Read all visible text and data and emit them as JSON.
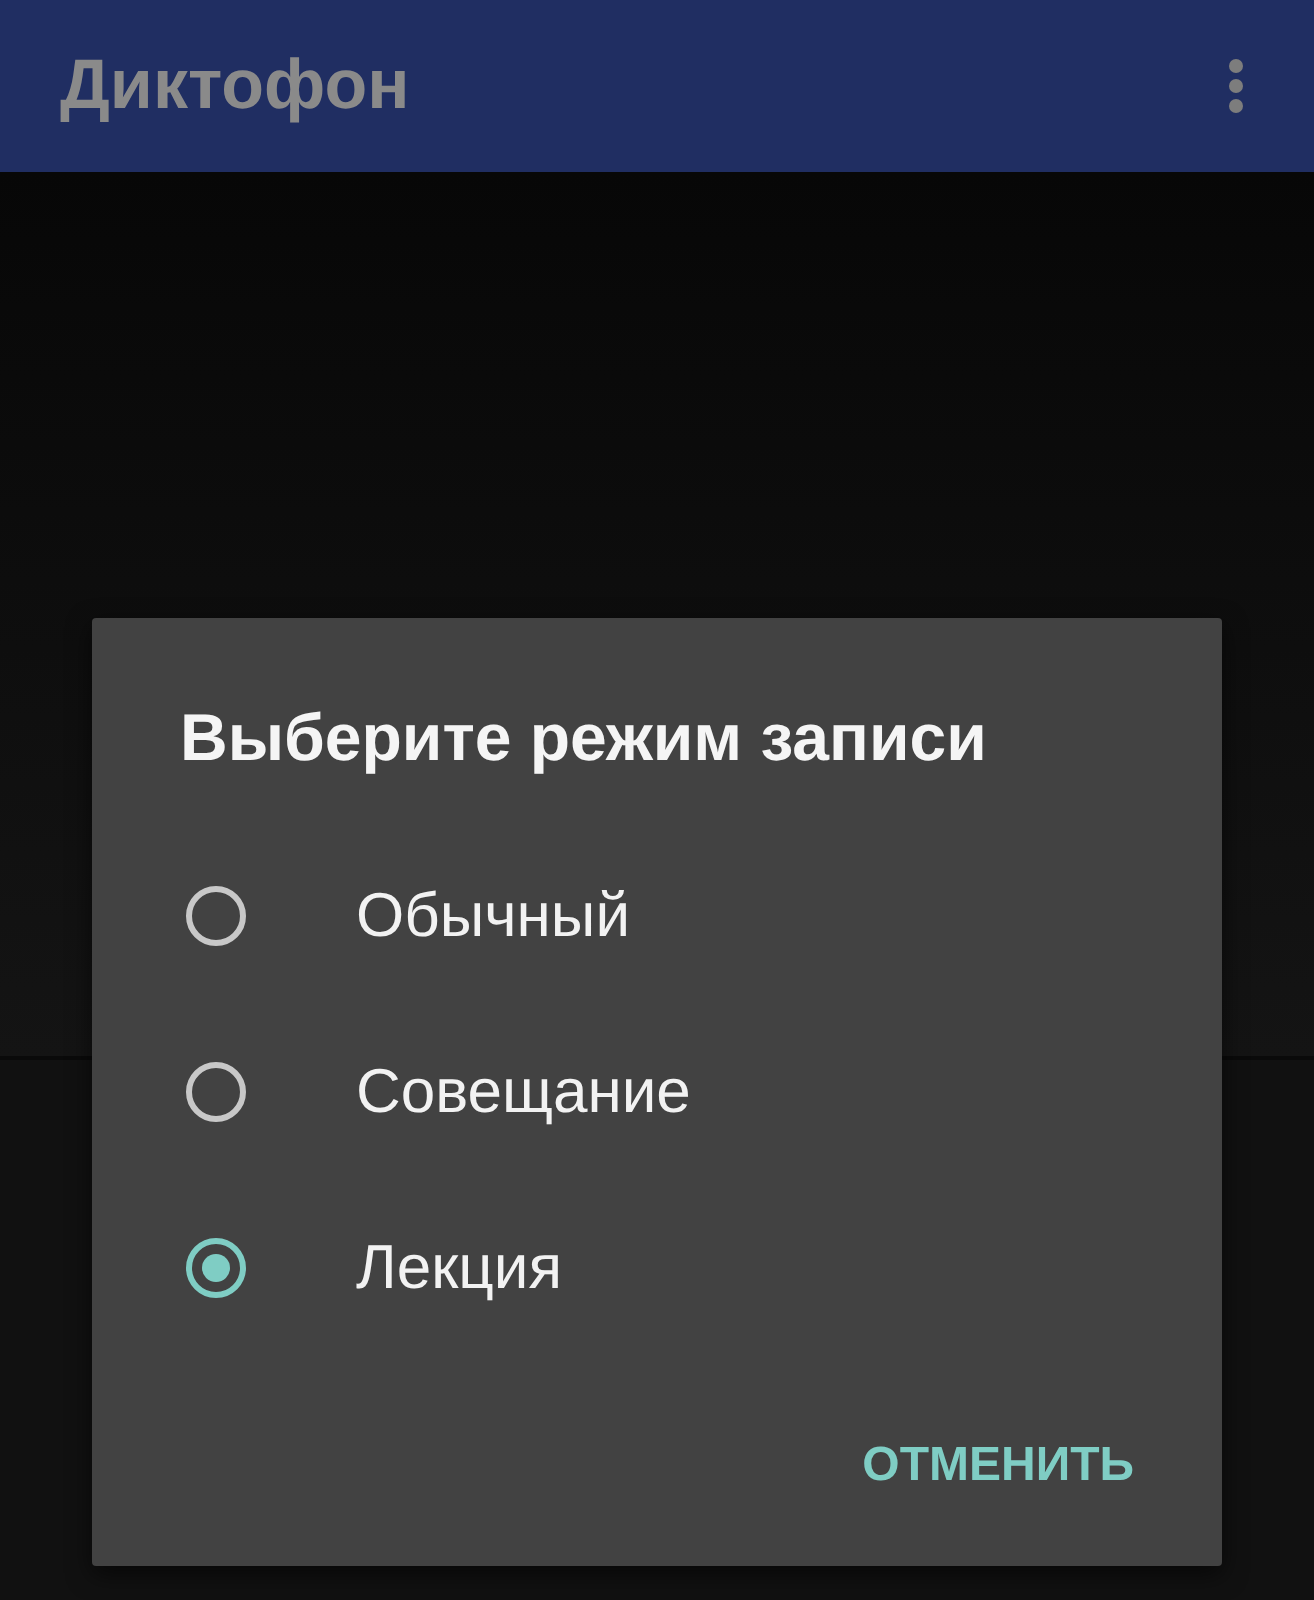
{
  "app_bar": {
    "title": "Диктофон"
  },
  "dialog": {
    "title": "Выберите режим записи",
    "options": [
      {
        "label": "Обычный",
        "selected": false
      },
      {
        "label": "Совещание",
        "selected": false
      },
      {
        "label": "Лекция",
        "selected": true
      }
    ],
    "buttons": [
      "ОТМЕНИТЬ"
    ]
  }
}
